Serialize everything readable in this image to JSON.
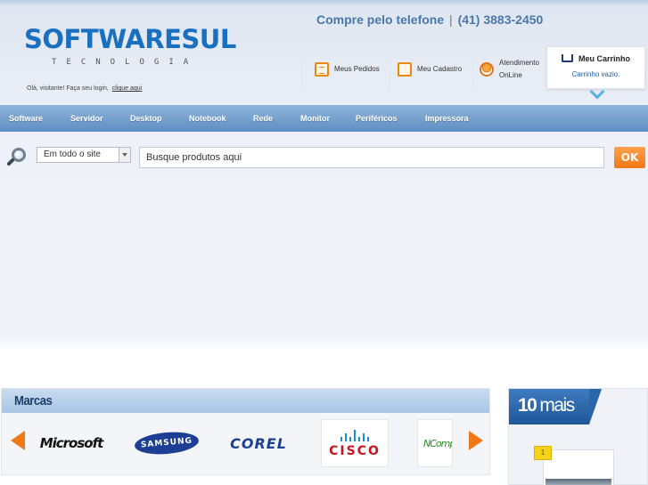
{
  "header": {
    "logo": {
      "name": "SOFTWARESUL",
      "tagline": "TECNOLOGIA"
    },
    "greeting": {
      "text": "Olá, visitante! Faça seu login,",
      "link": "clique aqui"
    },
    "phone": {
      "label": "Compre pelo telefone",
      "separator": "|",
      "number": "(41) 3883-2450"
    },
    "links": [
      {
        "label": "Meus Pedidos",
        "icon": "document-icon"
      },
      {
        "label": "Meu Cadastro",
        "icon": "edit-icon"
      },
      {
        "label_line1": "Atendimento",
        "label_line2": "OnLine",
        "icon": "support-person-icon"
      }
    ],
    "cart": {
      "title": "Meu Carrinho",
      "status": "Carrinho vazio.",
      "icon": "cart-icon"
    }
  },
  "nav": {
    "items": [
      "Software",
      "Servidor",
      "Desktop",
      "Notebook",
      "Rede",
      "Monitor",
      "Periféricos",
      "Impressora"
    ]
  },
  "search": {
    "scope_selected": "Em todo o site",
    "placeholder": "Busque produtos aqui",
    "value": "",
    "button_label": "OK"
  },
  "brands": {
    "title": "Marcas",
    "items": [
      "Microsoft",
      "SAMSUNG",
      "COREL",
      "CISCO",
      "NComputing"
    ]
  },
  "top10": {
    "number": "10",
    "label": "mais",
    "first_rank": "1"
  },
  "colors": {
    "brand_blue": "#1a6fc0",
    "nav_bar": "#6f9ccc",
    "accent_orange": "#f07817"
  }
}
